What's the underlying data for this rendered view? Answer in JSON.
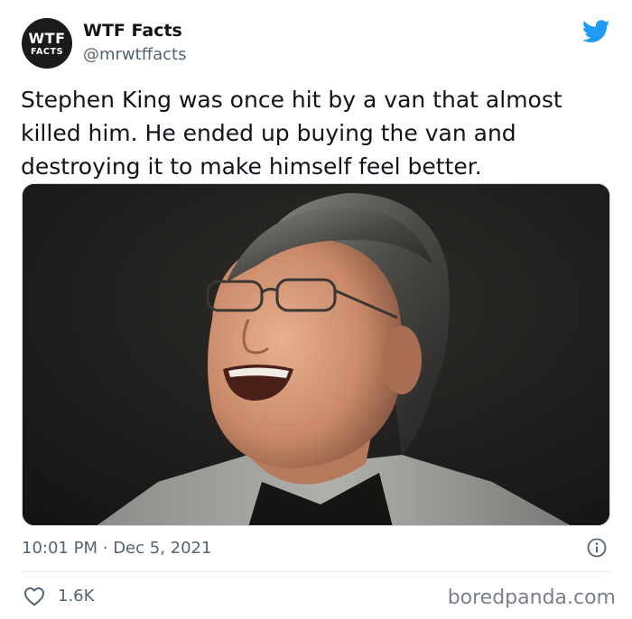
{
  "tweet": {
    "avatar": {
      "line1": "WTF",
      "line2": "FACTS"
    },
    "display_name": "WTF Facts",
    "handle": "@mrwtffacts",
    "text": "Stephen King was once hit by a van that almost killed him. He ended up buying the van and destroying it to make himself feel better.",
    "time": "10:01 PM",
    "separator": "·",
    "date": "Dec 5, 2021",
    "likes": "1.6K"
  },
  "icons": {
    "brand": "twitter-bird-icon",
    "info": "info-icon",
    "like": "heart-icon"
  },
  "colors": {
    "twitter_blue": "#1d9bf0",
    "secondary_text": "#536471",
    "primary_text": "#0f1419"
  },
  "watermark": "boredpanda.com"
}
